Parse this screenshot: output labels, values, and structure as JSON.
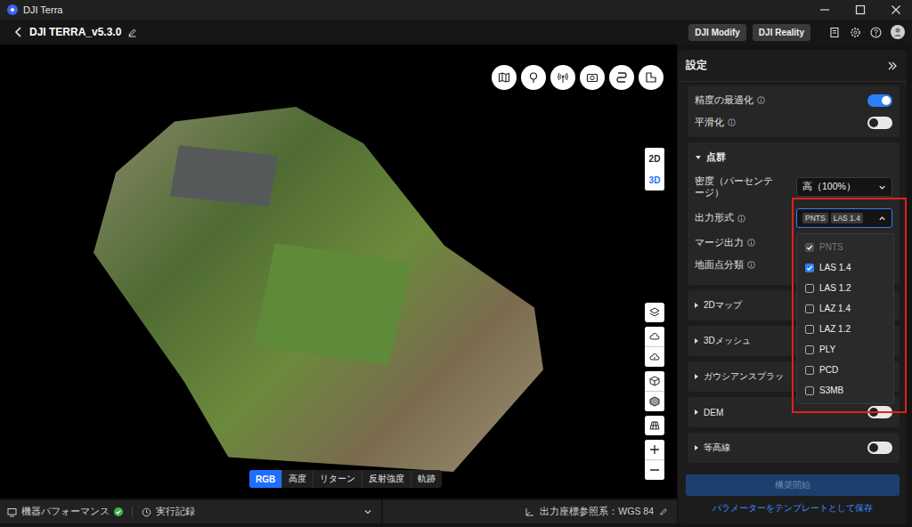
{
  "window": {
    "title": "DJI Terra"
  },
  "header": {
    "project": "DJI TERRA_v5.3.0",
    "buttons": [
      "DJI Modify",
      "DJI Reality"
    ]
  },
  "viewport": {
    "dimension_toggle": [
      {
        "label": "2D",
        "selected": false
      },
      {
        "label": "3D",
        "selected": true
      }
    ],
    "view_modes": [
      {
        "label": "RGB",
        "selected": true
      },
      {
        "label": "高度",
        "selected": false
      },
      {
        "label": "リターン",
        "selected": false
      },
      {
        "label": "反射強度",
        "selected": false
      },
      {
        "label": "軌跡",
        "selected": false
      }
    ]
  },
  "status_bar": {
    "performance": {
      "label": "機器パフォーマンス",
      "ok": true
    },
    "log": "実行記録",
    "crs": "出力座標参照系：WGS 84"
  },
  "settings": {
    "title": "設定",
    "toggles": [
      {
        "label": "精度の最適化",
        "on": true
      },
      {
        "label": "平滑化",
        "on": false
      }
    ],
    "point_cloud": {
      "title": "点群",
      "expanded": true,
      "density": {
        "label": "密度（パーセンテージ）",
        "value": "高（100%）"
      },
      "output_format": {
        "label": "出力形式",
        "tags": [
          "PNTS",
          "LAS 1.4"
        ],
        "open": true,
        "options": [
          {
            "label": "PNTS",
            "checked": true,
            "disabled": true
          },
          {
            "label": "LAS 1.4",
            "checked": true,
            "disabled": false
          },
          {
            "label": "LAS 1.2",
            "checked": false,
            "disabled": false
          },
          {
            "label": "LAZ 1.4",
            "checked": false,
            "disabled": false
          },
          {
            "label": "LAZ 1.2",
            "checked": false,
            "disabled": false
          },
          {
            "label": "PLY",
            "checked": false,
            "disabled": false
          },
          {
            "label": "PCD",
            "checked": false,
            "disabled": false
          },
          {
            "label": "S3MB",
            "checked": false,
            "disabled": false
          }
        ]
      },
      "rows": [
        "マージ出力",
        "地面点分類"
      ]
    },
    "sections": [
      {
        "title": "2Dマップ",
        "kind": "plain",
        "expanded": false
      },
      {
        "title": "3Dメッシュ",
        "kind": "plain",
        "expanded": false
      },
      {
        "title": "ガウシアンスプラッ",
        "kind": "plain",
        "expanded": false
      },
      {
        "title": "DEM",
        "kind": "toggle",
        "expanded": false,
        "on": false
      },
      {
        "title": "等高線",
        "kind": "toggle",
        "expanded": false,
        "on": false
      }
    ],
    "build_button": {
      "label": "構築開始",
      "disabled": true
    },
    "save_link": "パラメーターをテンプレートとして保存"
  }
}
